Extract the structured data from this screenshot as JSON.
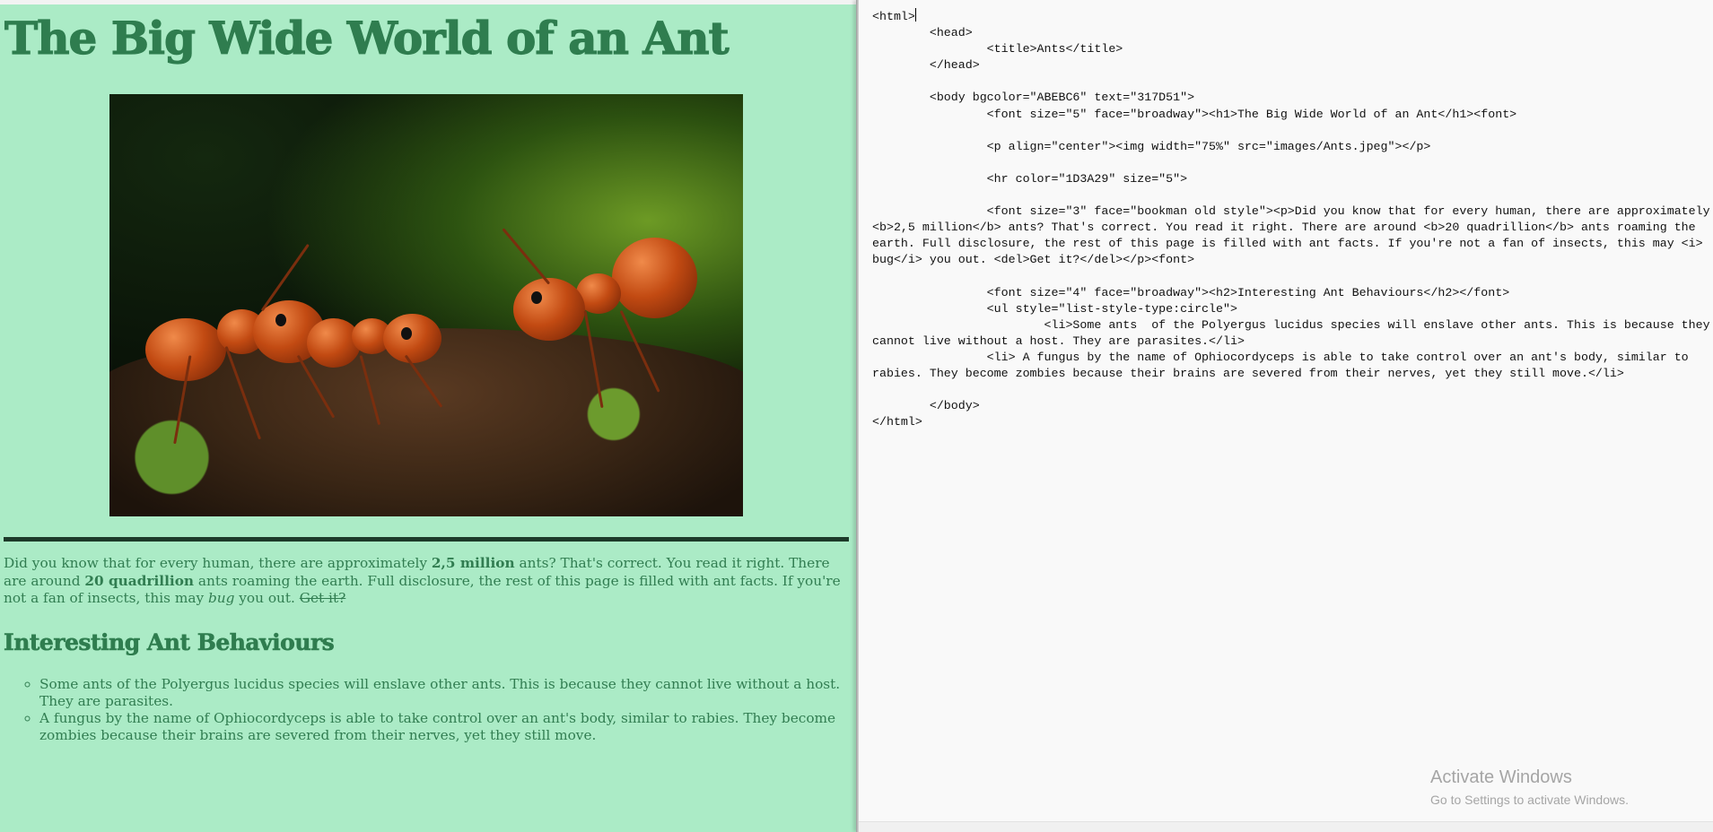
{
  "preview": {
    "title": "The Big Wide World of an Ant",
    "image": {
      "alt": "Ants",
      "description": "close-up of red ants on mossy soil"
    },
    "intro": {
      "p1": "Did you know that for every human, there are approximately ",
      "b1": "2,5 million",
      "p2": " ants? That's correct. You read it right. There are around ",
      "b2": "20 quadrillion",
      "p3": " ants roaming the earth. Full disclosure, the rest of this page is filled with ant facts. If you're not a fan of insects, this may ",
      "i1": "bug",
      "p4": " you out. ",
      "del": "Get it?"
    },
    "section_heading": "Interesting Ant Behaviours",
    "list": [
      "Some ants of the Polyergus lucidus species will enslave other ants. This is because they cannot live without a host. They are parasites.",
      "A fungus by the name of Ophiocordyceps is able to take control over an ant's body, similar to rabies. They become zombies because their brains are severed from their nerves, yet they still move."
    ],
    "colors": {
      "background": "#ABEBC6",
      "text": "#317D51",
      "rule": "#1D3A29"
    }
  },
  "editor": {
    "lines": [
      "<html>",
      "        <head>",
      "                <title>Ants</title>",
      "        </head>",
      "",
      "        <body bgcolor=\"ABEBC6\" text=\"317D51\">",
      "                <font size=\"5\" face=\"broadway\"><h1>The Big Wide World of an Ant</h1><font>",
      "",
      "                <p align=\"center\"><img width=\"75%\" src=\"images/Ants.jpeg\"></p>",
      "",
      "                <hr color=\"1D3A29\" size=\"5\">",
      "",
      "                <font size=\"3\" face=\"bookman old style\"><p>Did you know that for every human, there are approximately",
      "<b>2,5 million</b> ants? That's correct. You read it right. There are around <b>20 quadrillion</b> ants roaming the",
      "earth. Full disclosure, the rest of this page is filled with ant facts. If you're not a fan of insects, this may <i>",
      "bug</i> you out. <del>Get it?</del></p><font>",
      "",
      "                <font size=\"4\" face=\"broadway\"><h2>Interesting Ant Behaviours</h2></font>",
      "                <ul style=\"list-style-type:circle\">",
      "                        <li>Some ants  of the Polyergus lucidus species will enslave other ants. This is because they",
      "cannot live without a host. They are parasites.</li>",
      "                <li> A fungus by the name of Ophiocordyceps is able to take control over an ant's body, similar to",
      "rabies. They become zombies because their brains are severed from their nerves, yet they still move.</li>",
      "",
      "        </body>",
      "</html>"
    ]
  },
  "watermark": {
    "title": "Activate Windows",
    "subtitle": "Go to Settings to activate Windows."
  }
}
